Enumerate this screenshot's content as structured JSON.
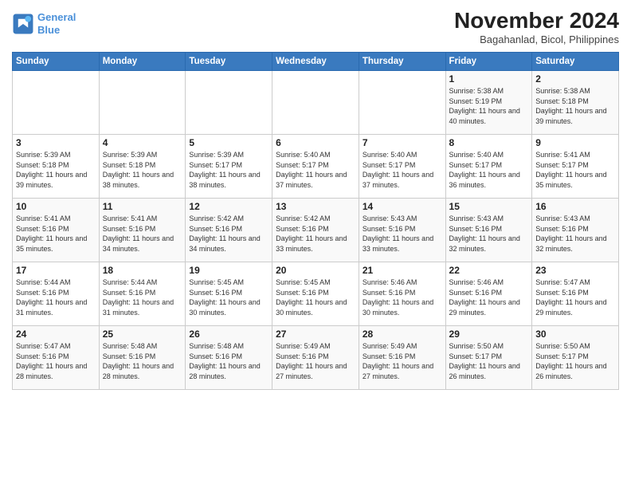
{
  "logo": {
    "line1": "General",
    "line2": "Blue"
  },
  "title": "November 2024",
  "subtitle": "Bagahanlad, Bicol, Philippines",
  "days_of_week": [
    "Sunday",
    "Monday",
    "Tuesday",
    "Wednesday",
    "Thursday",
    "Friday",
    "Saturday"
  ],
  "weeks": [
    [
      {
        "day": "",
        "info": ""
      },
      {
        "day": "",
        "info": ""
      },
      {
        "day": "",
        "info": ""
      },
      {
        "day": "",
        "info": ""
      },
      {
        "day": "",
        "info": ""
      },
      {
        "day": "1",
        "info": "Sunrise: 5:38 AM\nSunset: 5:19 PM\nDaylight: 11 hours and 40 minutes."
      },
      {
        "day": "2",
        "info": "Sunrise: 5:38 AM\nSunset: 5:18 PM\nDaylight: 11 hours and 39 minutes."
      }
    ],
    [
      {
        "day": "3",
        "info": "Sunrise: 5:39 AM\nSunset: 5:18 PM\nDaylight: 11 hours and 39 minutes."
      },
      {
        "day": "4",
        "info": "Sunrise: 5:39 AM\nSunset: 5:18 PM\nDaylight: 11 hours and 38 minutes."
      },
      {
        "day": "5",
        "info": "Sunrise: 5:39 AM\nSunset: 5:17 PM\nDaylight: 11 hours and 38 minutes."
      },
      {
        "day": "6",
        "info": "Sunrise: 5:40 AM\nSunset: 5:17 PM\nDaylight: 11 hours and 37 minutes."
      },
      {
        "day": "7",
        "info": "Sunrise: 5:40 AM\nSunset: 5:17 PM\nDaylight: 11 hours and 37 minutes."
      },
      {
        "day": "8",
        "info": "Sunrise: 5:40 AM\nSunset: 5:17 PM\nDaylight: 11 hours and 36 minutes."
      },
      {
        "day": "9",
        "info": "Sunrise: 5:41 AM\nSunset: 5:17 PM\nDaylight: 11 hours and 35 minutes."
      }
    ],
    [
      {
        "day": "10",
        "info": "Sunrise: 5:41 AM\nSunset: 5:16 PM\nDaylight: 11 hours and 35 minutes."
      },
      {
        "day": "11",
        "info": "Sunrise: 5:41 AM\nSunset: 5:16 PM\nDaylight: 11 hours and 34 minutes."
      },
      {
        "day": "12",
        "info": "Sunrise: 5:42 AM\nSunset: 5:16 PM\nDaylight: 11 hours and 34 minutes."
      },
      {
        "day": "13",
        "info": "Sunrise: 5:42 AM\nSunset: 5:16 PM\nDaylight: 11 hours and 33 minutes."
      },
      {
        "day": "14",
        "info": "Sunrise: 5:43 AM\nSunset: 5:16 PM\nDaylight: 11 hours and 33 minutes."
      },
      {
        "day": "15",
        "info": "Sunrise: 5:43 AM\nSunset: 5:16 PM\nDaylight: 11 hours and 32 minutes."
      },
      {
        "day": "16",
        "info": "Sunrise: 5:43 AM\nSunset: 5:16 PM\nDaylight: 11 hours and 32 minutes."
      }
    ],
    [
      {
        "day": "17",
        "info": "Sunrise: 5:44 AM\nSunset: 5:16 PM\nDaylight: 11 hours and 31 minutes."
      },
      {
        "day": "18",
        "info": "Sunrise: 5:44 AM\nSunset: 5:16 PM\nDaylight: 11 hours and 31 minutes."
      },
      {
        "day": "19",
        "info": "Sunrise: 5:45 AM\nSunset: 5:16 PM\nDaylight: 11 hours and 30 minutes."
      },
      {
        "day": "20",
        "info": "Sunrise: 5:45 AM\nSunset: 5:16 PM\nDaylight: 11 hours and 30 minutes."
      },
      {
        "day": "21",
        "info": "Sunrise: 5:46 AM\nSunset: 5:16 PM\nDaylight: 11 hours and 30 minutes."
      },
      {
        "day": "22",
        "info": "Sunrise: 5:46 AM\nSunset: 5:16 PM\nDaylight: 11 hours and 29 minutes."
      },
      {
        "day": "23",
        "info": "Sunrise: 5:47 AM\nSunset: 5:16 PM\nDaylight: 11 hours and 29 minutes."
      }
    ],
    [
      {
        "day": "24",
        "info": "Sunrise: 5:47 AM\nSunset: 5:16 PM\nDaylight: 11 hours and 28 minutes."
      },
      {
        "day": "25",
        "info": "Sunrise: 5:48 AM\nSunset: 5:16 PM\nDaylight: 11 hours and 28 minutes."
      },
      {
        "day": "26",
        "info": "Sunrise: 5:48 AM\nSunset: 5:16 PM\nDaylight: 11 hours and 28 minutes."
      },
      {
        "day": "27",
        "info": "Sunrise: 5:49 AM\nSunset: 5:16 PM\nDaylight: 11 hours and 27 minutes."
      },
      {
        "day": "28",
        "info": "Sunrise: 5:49 AM\nSunset: 5:16 PM\nDaylight: 11 hours and 27 minutes."
      },
      {
        "day": "29",
        "info": "Sunrise: 5:50 AM\nSunset: 5:17 PM\nDaylight: 11 hours and 26 minutes."
      },
      {
        "day": "30",
        "info": "Sunrise: 5:50 AM\nSunset: 5:17 PM\nDaylight: 11 hours and 26 minutes."
      }
    ]
  ]
}
